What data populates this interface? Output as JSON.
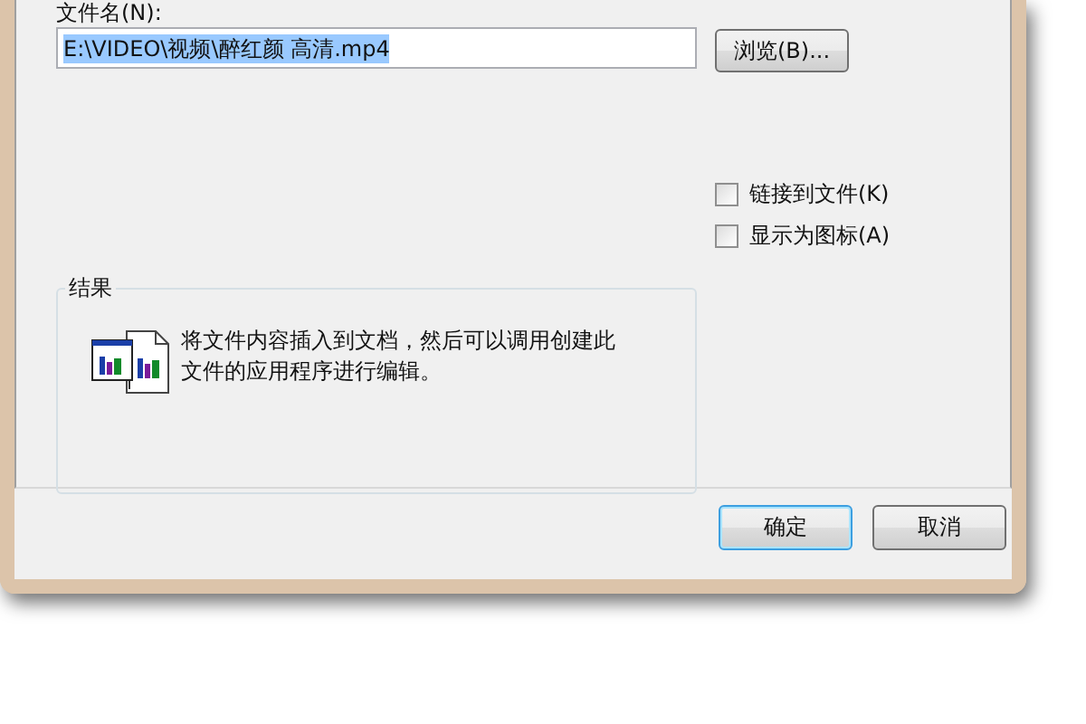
{
  "file_name": {
    "label": "文件名(N):",
    "value": "E:\\VIDEO\\视频\\醉红颜 高清.mp4",
    "value_selected": true,
    "browse_button": "浏览(B)..."
  },
  "options": [
    {
      "label": "链接到文件(K)",
      "checked": false
    },
    {
      "label": "显示为图标(A)",
      "checked": false
    }
  ],
  "result": {
    "title": "结果",
    "description": "将文件内容插入到文档，然后可以调用创建此文件的应用程序进行编辑。"
  },
  "buttons": [
    {
      "label": "确定",
      "default": true
    },
    {
      "label": "取消",
      "default": false
    }
  ]
}
